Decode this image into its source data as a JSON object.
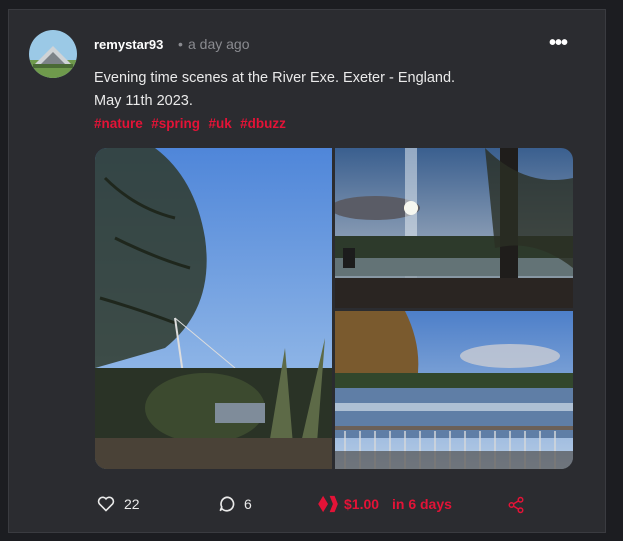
{
  "post": {
    "username": "remystar93",
    "separator": "•",
    "time": "a day ago",
    "menu_icon": "•••",
    "body_line1": "Evening time scenes at the River Exe. Exeter - England.",
    "body_line2": "May 11th 2023.",
    "tags": [
      "#nature",
      "#spring",
      "#uk",
      "#dbuzz"
    ],
    "images": [
      {
        "icon": "image-icon",
        "subject": "tree against blue sky by the river"
      },
      {
        "icon": "image-icon",
        "subject": "sun over river through window"
      },
      {
        "icon": "image-icon",
        "subject": "river weir view from railing"
      }
    ]
  },
  "actions": {
    "likes": "22",
    "comments": "6",
    "payout": "$1.00",
    "payout_time": "in 6 days"
  },
  "colors": {
    "accent": "#e31337",
    "card_bg": "#2b2c30",
    "page_bg": "#1c1d21"
  }
}
